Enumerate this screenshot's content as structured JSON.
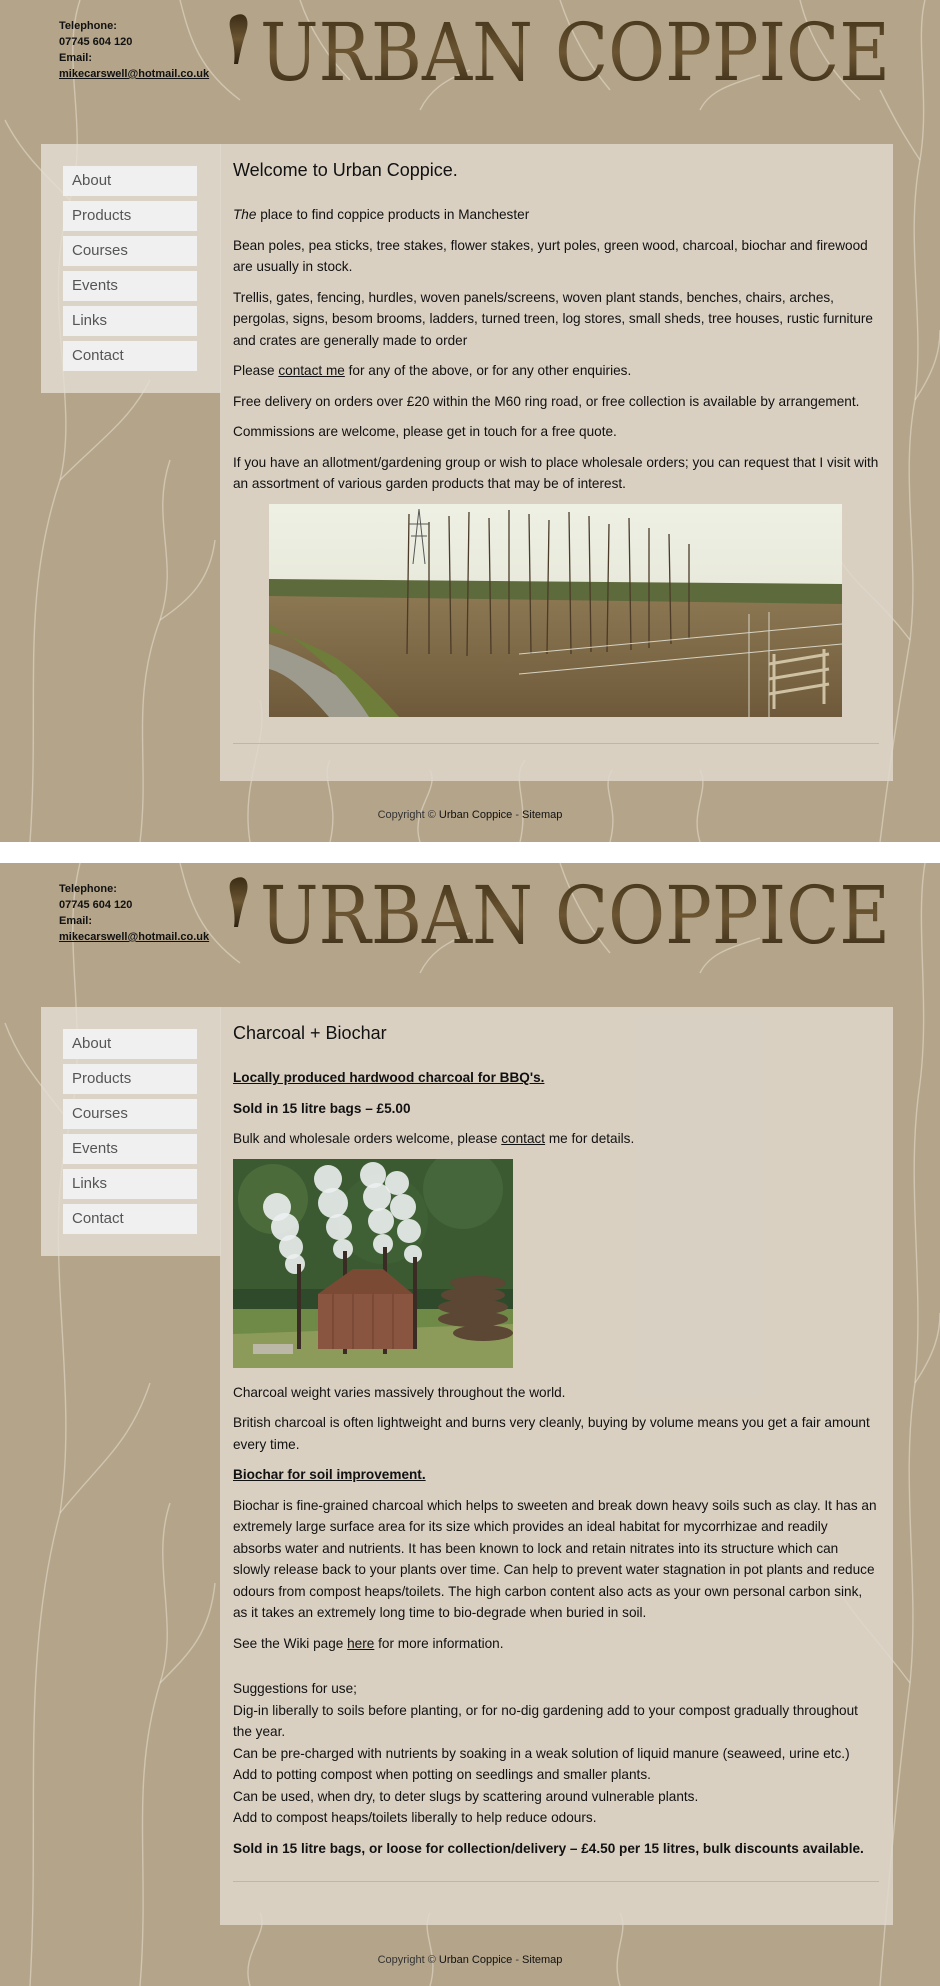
{
  "header": {
    "telephone_label": "Telephone:",
    "telephone": "07745 604 120",
    "email_label": "Email:",
    "email": "mikecarswell@hotmail.co.uk",
    "logo_text": "URBAN COPPICE"
  },
  "nav": {
    "items": [
      {
        "label": "About"
      },
      {
        "label": "Products"
      },
      {
        "label": "Courses"
      },
      {
        "label": "Events"
      },
      {
        "label": "Links"
      },
      {
        "label": "Contact"
      }
    ]
  },
  "page1": {
    "heading": "Welcome to Urban Coppice.",
    "intro_em": "The",
    "intro_rest": " place to find coppice products in Manchester",
    "p_stock": "Bean poles, pea sticks, tree stakes, flower stakes, yurt poles, green wood, charcoal, biochar and firewood are usually in stock.",
    "p_made": "Trellis, gates, fencing, hurdles, woven panels/screens, woven plant stands, benches, chairs, arches, pergolas, signs, besom brooms, ladders, turned treen, log stores, small sheds, tree houses, rustic furniture and crates are generally made to order",
    "p_contact_before": "Please ",
    "p_contact_link": "contact me",
    "p_contact_after": " for any of the above, or for any other enquiries.",
    "p_delivery": "Free delivery on orders over £20 within the M60 ring road, or free collection is available by arrangement.",
    "p_commissions": "Commissions are welcome, please get in touch for a free quote.",
    "p_allotment": "If you have an allotment/gardening group or wish to place wholesale orders; you can request that I visit with an assortment of various garden products that may be of interest."
  },
  "page2": {
    "heading": "Charcoal + Biochar",
    "charcoal_heading": "Locally produced hardwood charcoal for BBQ's.",
    "charcoal_price": "Sold in 15 litre bags – £5.00",
    "bulk_before": "Bulk and wholesale orders welcome, please ",
    "bulk_link": "contact",
    "bulk_after": " me for details.",
    "p_weight": "Charcoal weight varies massively throughout the world.",
    "p_british": "British charcoal is often lightweight and burns very cleanly, buying by volume means you get a fair amount every time.",
    "biochar_heading": "Biochar for soil improvement.",
    "p_biochar": "Biochar is fine-grained charcoal which helps to sweeten and break down heavy soils such as clay. It has an extremely large surface area for its size which provides an ideal habitat for mycorrhizae and readily absorbs water and nutrients. It has been known to lock and retain nitrates into its structure which can slowly release back to your plants over time. Can help to prevent water stagnation in pot plants and reduce odours from compost heaps/toilets. The high carbon content also acts as your own personal carbon sink, as it takes an extremely long time to bio-degrade when buried in soil.",
    "wiki_before": "See the Wiki page ",
    "wiki_link": "here",
    "wiki_after": " for more information.",
    "suggestions": [
      "Suggestions for use;",
      "Dig-in liberally to soils before planting, or for no-dig gardening add to your compost gradually throughout the year.",
      "Can be pre-charged with nutrients by soaking in a weak solution of liquid manure (seaweed, urine etc.)",
      "Add to potting compost when potting on seedlings and smaller plants.",
      "Can be used, when dry, to deter slugs by scattering around vulnerable plants.",
      "Add to compost heaps/toilets liberally to help reduce odours."
    ],
    "final_price": "Sold in 15 litre bags, or loose for collection/delivery – £4.50 per 15 litres, bulk discounts available."
  },
  "footer": {
    "copyright": "Copyright © ",
    "site_link": "Urban Coppice",
    "separator": " - ",
    "sitemap_link": "Sitemap"
  },
  "colors": {
    "background": "#b4a58a",
    "panel": "#ded7cc",
    "nav_button": "#f1f0f0",
    "logo": "#4a3a22"
  }
}
